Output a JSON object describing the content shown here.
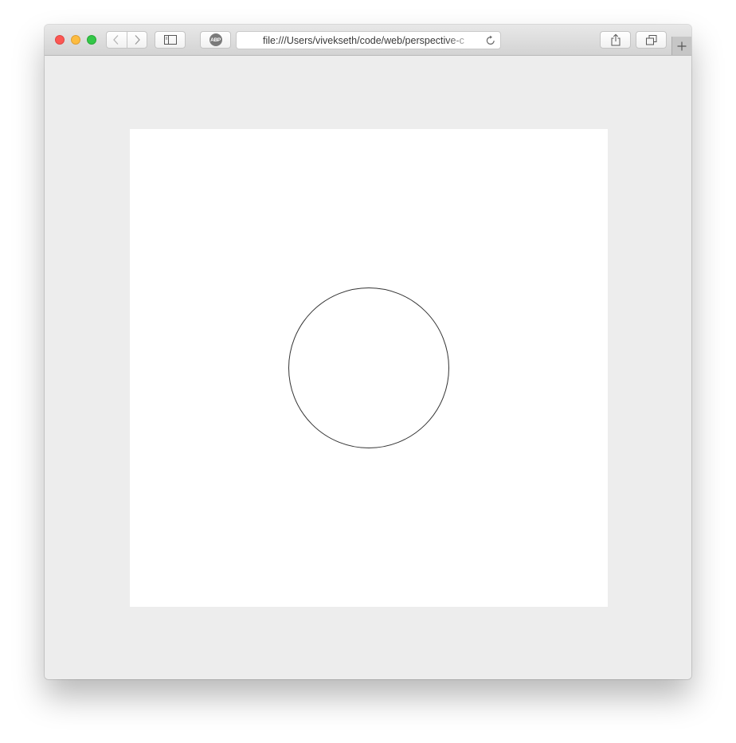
{
  "browser": {
    "address_bar": {
      "url": "file:///Users/vivekseth/code/web/perspective-c"
    },
    "toolbar": {
      "adblock_badge": "ABP",
      "icons": [
        "chevron-left-icon",
        "chevron-right-icon",
        "sidebar-icon",
        "reload-icon",
        "share-icon",
        "tabs-overview-icon",
        "plus-icon"
      ]
    }
  },
  "colors": {
    "close": "#fc5753",
    "minimize": "#fdbc40",
    "maximize": "#33c748",
    "page_background": "#ededed",
    "canvas_background": "#ffffff",
    "circle_stroke": "#333333"
  }
}
